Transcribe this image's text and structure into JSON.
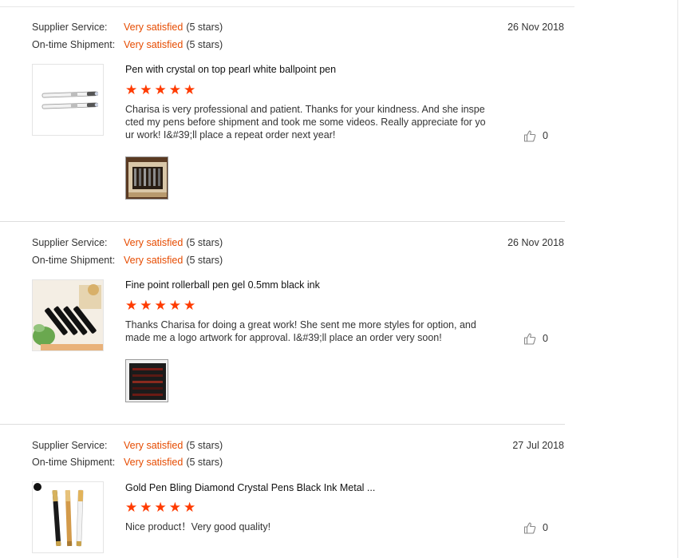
{
  "labels": {
    "supplier_service": "Supplier Service:",
    "on_time_shipment": "On-time Shipment:"
  },
  "colors": {
    "satisfaction_text": "#e64b00",
    "stars": "#ff3b00"
  },
  "icons": {
    "like": "thumbs-up-icon",
    "star": "star-icon"
  },
  "reviews": [
    {
      "supplier_value": "Very satisfied",
      "supplier_stars": "(5 stars)",
      "shipment_value": "Very satisfied",
      "shipment_stars": "(5 stars)",
      "date": "26 Nov 2018",
      "product_title": "Pen with crystal on top pearl white ballpoint pen",
      "rating": 5,
      "text": "Charisa is very professional and patient. Thanks for your kindness. And she inspected my pens before shipment and took me some videos. Really appreciate for your work! I&#39;ll place a repeat order next year!",
      "likes": "0"
    },
    {
      "supplier_value": "Very satisfied",
      "supplier_stars": "(5 stars)",
      "shipment_value": "Very satisfied",
      "shipment_stars": "(5 stars)",
      "date": "26 Nov 2018",
      "product_title": "Fine point rollerball pen gel 0.5mm black ink",
      "rating": 5,
      "text": "Thanks Charisa for doing a great work! She sent me more styles for option, and made me a logo artwork for approval. I&#39;ll place an order very soon!",
      "likes": "0"
    },
    {
      "supplier_value": "Very satisfied",
      "supplier_stars": "(5 stars)",
      "shipment_value": "Very satisfied",
      "shipment_stars": "(5 stars)",
      "date": "27 Jul 2018",
      "product_title": "Gold Pen Bling Diamond Crystal Pens Black Ink Metal ...",
      "rating": 5,
      "text": "Nice product！Very good quality!",
      "likes": "0"
    }
  ]
}
